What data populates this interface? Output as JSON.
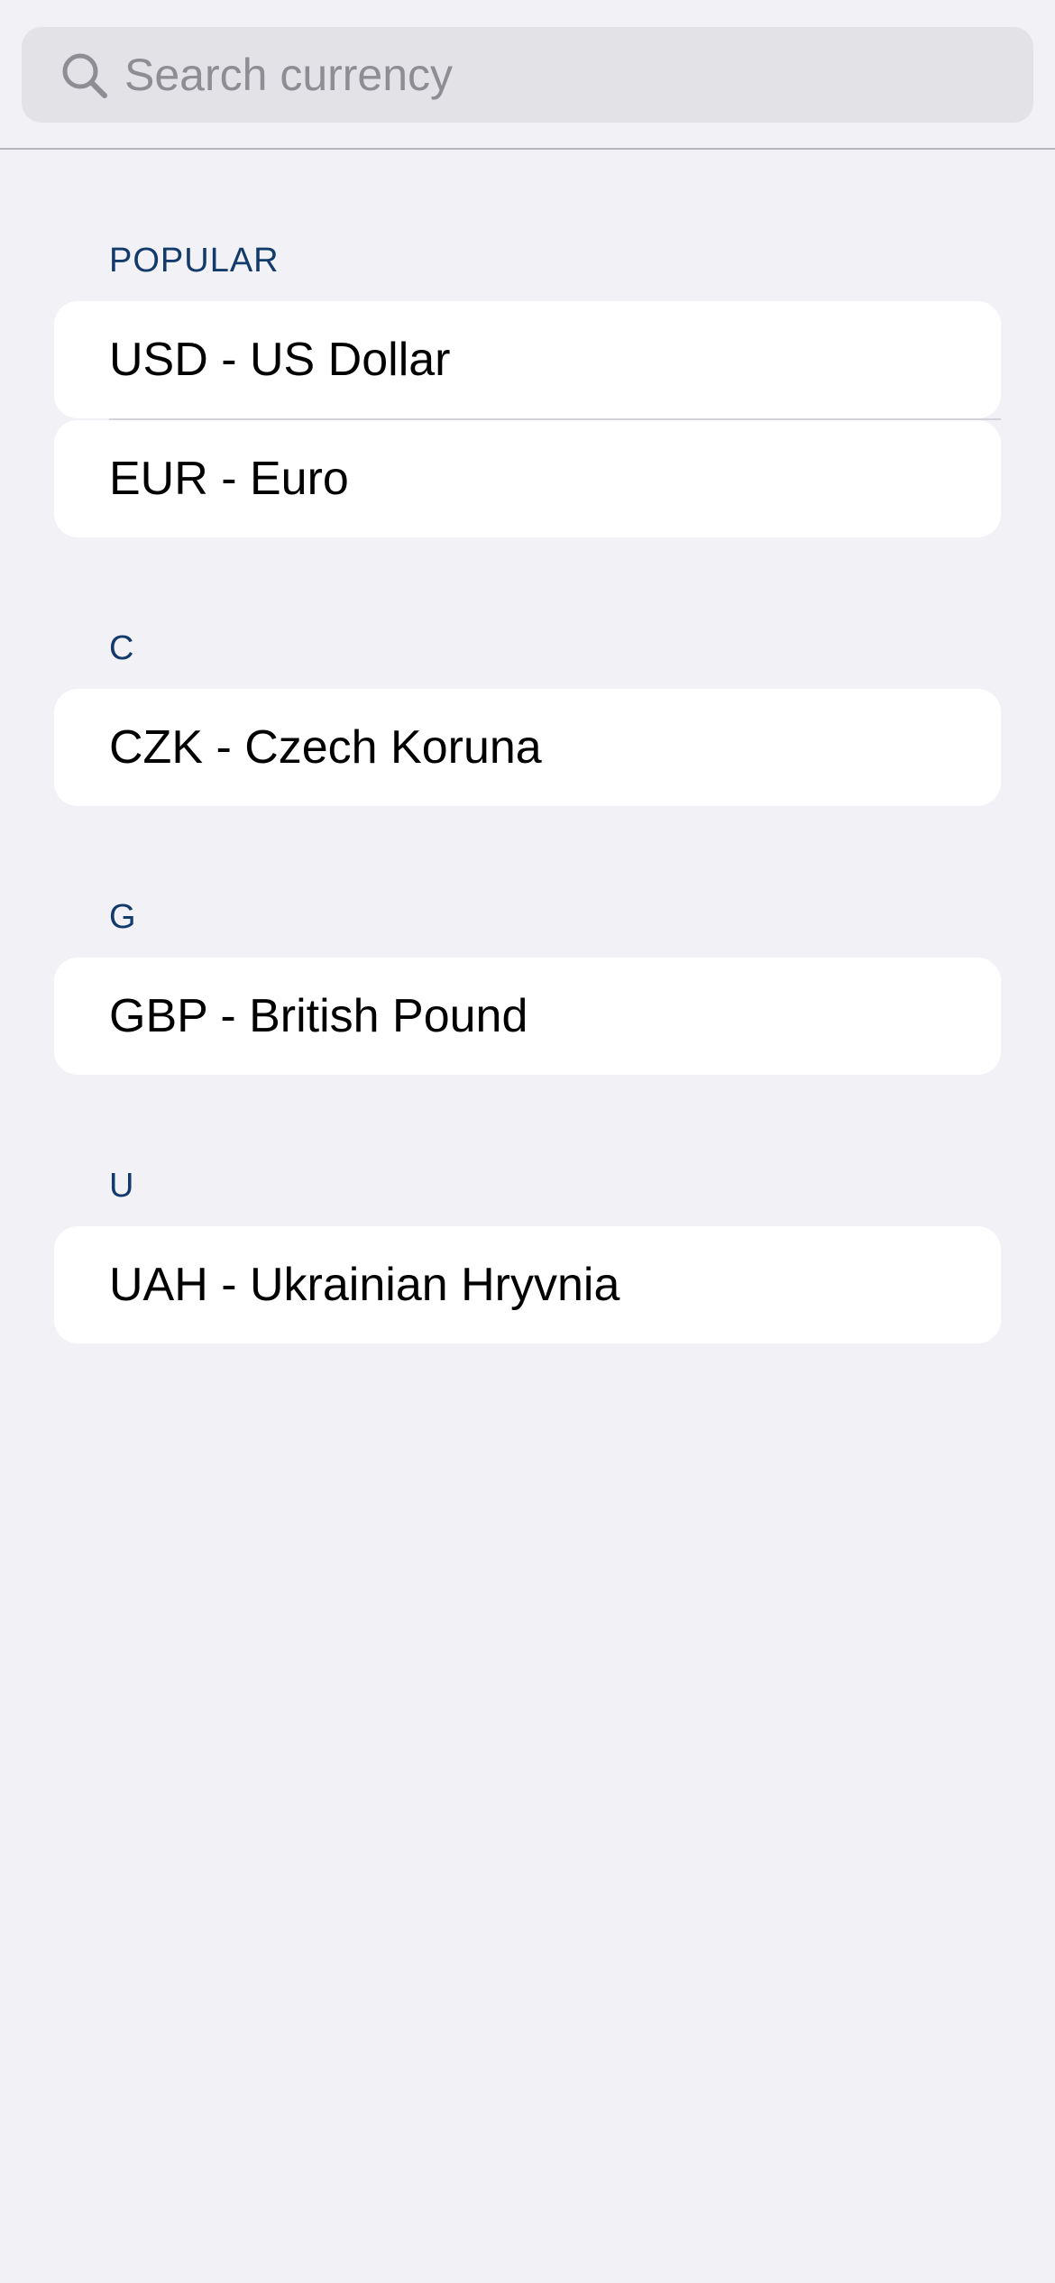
{
  "search": {
    "placeholder": "Search currency",
    "value": ""
  },
  "sections": [
    {
      "header": "POPULAR",
      "items": [
        {
          "label": "USD - US Dollar"
        },
        {
          "label": "EUR - Euro"
        }
      ]
    },
    {
      "header": "C",
      "items": [
        {
          "label": "CZK - Czech Koruna"
        }
      ]
    },
    {
      "header": "G",
      "items": [
        {
          "label": "GBP - British Pound"
        }
      ]
    },
    {
      "header": "U",
      "items": [
        {
          "label": "UAH - Ukrainian Hryvnia"
        }
      ]
    }
  ],
  "colors": {
    "background": "#f1f1f6",
    "search_bar": "#e2e2e7",
    "section_header": "#123a6b",
    "placeholder": "#8d8d93"
  }
}
